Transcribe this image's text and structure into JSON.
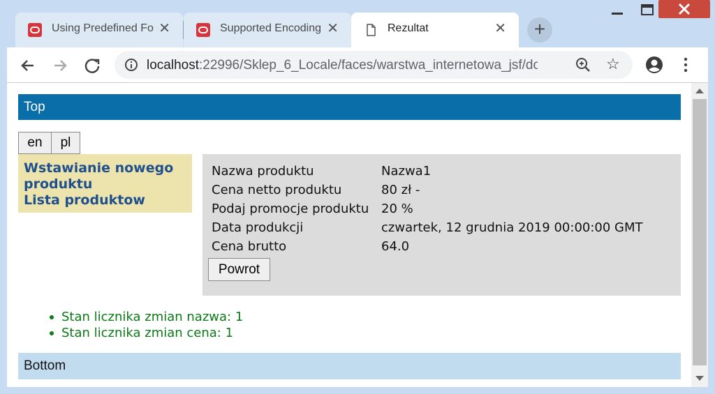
{
  "browser": {
    "tabs": [
      {
        "title": "Using Predefined Fo",
        "icon": "oracle-icon",
        "close": "✕"
      },
      {
        "title": "Supported Encoding",
        "icon": "oracle-icon",
        "close": "✕"
      },
      {
        "title": "Rezultat",
        "icon": "document-icon",
        "close": "✕"
      }
    ],
    "new_tab": "+",
    "url_host": "localhost",
    "url_rest": ":22996/Sklep_6_Locale/faces/warstwa_internetowa_jsf/do...",
    "star": "☆",
    "colors": {
      "accent_top": "#0a6fa8",
      "nav_bg": "#ede4ad",
      "counter_text": "#0b7a17",
      "bottom_bg": "#c2dcef"
    }
  },
  "page": {
    "top": "Top",
    "lang_buttons": [
      "en",
      "pl"
    ],
    "nav": [
      "Wstawianie nowego produktu",
      "Lista produktow"
    ],
    "details": [
      {
        "label": "Nazwa produktu",
        "value": "Nazwa1"
      },
      {
        "label": "Cena netto produktu",
        "value": "80 zł -"
      },
      {
        "label": "Podaj promocje produktu",
        "value": "20 %"
      },
      {
        "label": "Data produkcji",
        "value": "czwartek, 12 grudnia 2019 00:00:00 GMT"
      },
      {
        "label": "Cena brutto",
        "value": "64.0"
      }
    ],
    "back_button": "Powrot",
    "counters": [
      "Stan licznika zmian nazwa: 1",
      "Stan licznika zmian cena: 1"
    ],
    "bottom": "Bottom"
  }
}
